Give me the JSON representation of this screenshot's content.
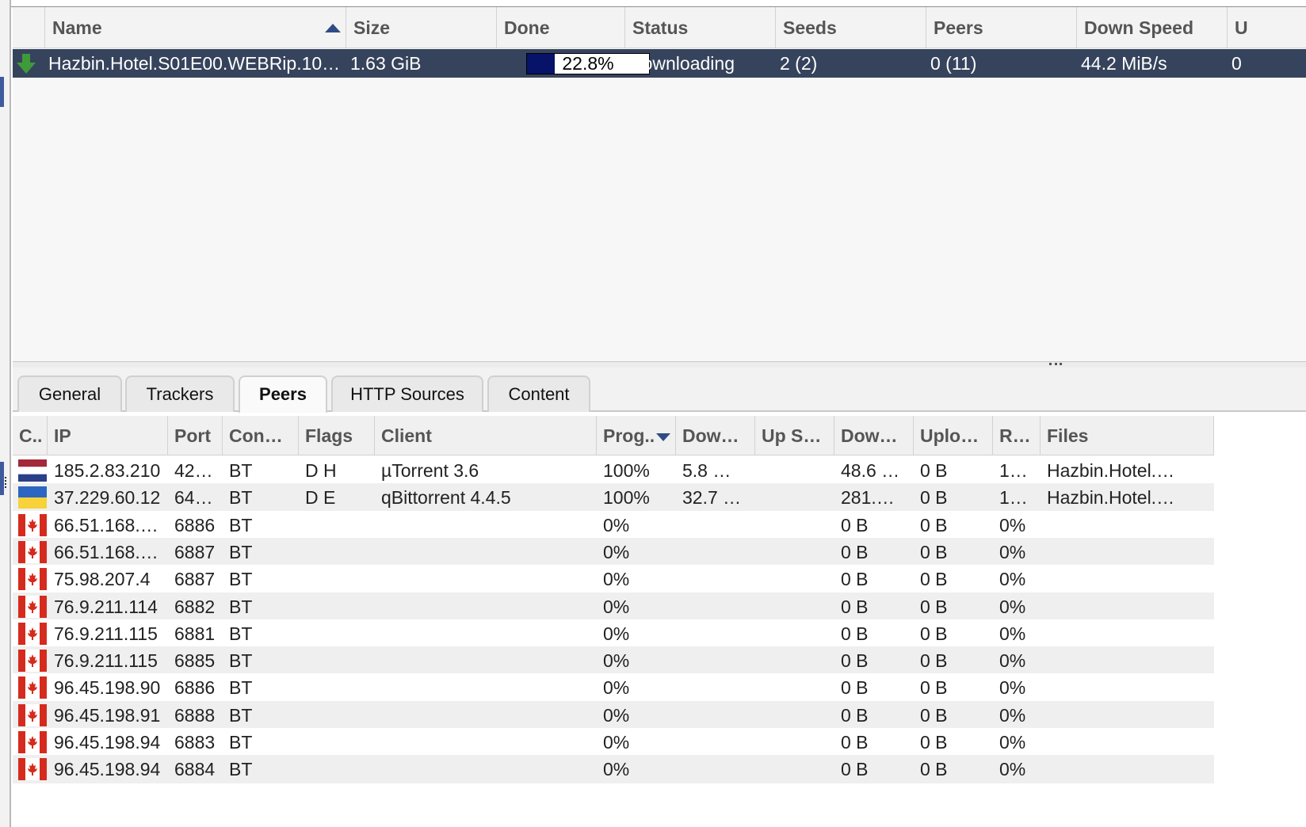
{
  "torrent_list": {
    "columns": {
      "icon": "",
      "name": "Name",
      "size": "Size",
      "done": "Done",
      "status": "Status",
      "seeds": "Seeds",
      "peers": "Peers",
      "down_speed": "Down Speed",
      "up_speed": "U"
    },
    "sorted_column": "name",
    "sort_direction": "ascending",
    "rows": [
      {
        "state_icon": "download-arrow-icon",
        "name": "Hazbin.Hotel.S01E00.WEBRip.10…",
        "size": "1.63 GiB",
        "done_percent": 22.8,
        "done_label": "22.8%",
        "status": "Downloading",
        "seeds": "2 (2)",
        "peers": "0 (11)",
        "down_speed": "44.2 MiB/s",
        "up_speed": "0"
      }
    ]
  },
  "colors": {
    "selected_row_bg": "#36435c",
    "progress_fill": "#071269",
    "sort_indicator": "#2f4b85"
  },
  "tabs": [
    {
      "label": "General",
      "active": false
    },
    {
      "label": "Trackers",
      "active": false
    },
    {
      "label": "Peers",
      "active": true
    },
    {
      "label": "HTTP Sources",
      "active": false
    },
    {
      "label": "Content",
      "active": false
    }
  ],
  "peers": {
    "columns": {
      "country": "C..",
      "ip": "IP",
      "port": "Port",
      "connection": "Con…",
      "flags": "Flags",
      "client": "Client",
      "progress": "Prog..",
      "down_speed": "Dow…",
      "up_speed": "Up S…",
      "downloaded": "Dow…",
      "uploaded": "Uplo…",
      "relevance": "R…",
      "files": "Files"
    },
    "sorted_column": "progress",
    "sort_direction": "descending",
    "rows": [
      {
        "flag": "netherlands",
        "ip": "185.2.83.210",
        "port": "42…",
        "connection": "BT",
        "flags": "D H",
        "client": "µTorrent 3.6",
        "progress": "100%",
        "down_speed": "5.8 …",
        "up_speed": "",
        "downloaded": "48.6 …",
        "uploaded": "0 B",
        "relevance": "1…",
        "files": "Hazbin.Hotel.…"
      },
      {
        "flag": "ukraine",
        "ip": "37.229.60.12",
        "port": "64…",
        "connection": "BT",
        "flags": "D E",
        "client": "qBittorrent 4.4.5",
        "progress": "100%",
        "down_speed": "32.7 …",
        "up_speed": "",
        "downloaded": "281.…",
        "uploaded": "0 B",
        "relevance": "1…",
        "files": "Hazbin.Hotel.…"
      },
      {
        "flag": "canada",
        "ip": "66.51.168.…",
        "port": "6886",
        "connection": "BT",
        "flags": "",
        "client": "",
        "progress": "0%",
        "down_speed": "",
        "up_speed": "",
        "downloaded": "0 B",
        "uploaded": "0 B",
        "relevance": "0%",
        "files": ""
      },
      {
        "flag": "canada",
        "ip": "66.51.168.…",
        "port": "6887",
        "connection": "BT",
        "flags": "",
        "client": "",
        "progress": "0%",
        "down_speed": "",
        "up_speed": "",
        "downloaded": "0 B",
        "uploaded": "0 B",
        "relevance": "0%",
        "files": ""
      },
      {
        "flag": "canada",
        "ip": "75.98.207.4",
        "port": "6887",
        "connection": "BT",
        "flags": "",
        "client": "",
        "progress": "0%",
        "down_speed": "",
        "up_speed": "",
        "downloaded": "0 B",
        "uploaded": "0 B",
        "relevance": "0%",
        "files": ""
      },
      {
        "flag": "canada",
        "ip": "76.9.211.114",
        "port": "6882",
        "connection": "BT",
        "flags": "",
        "client": "",
        "progress": "0%",
        "down_speed": "",
        "up_speed": "",
        "downloaded": "0 B",
        "uploaded": "0 B",
        "relevance": "0%",
        "files": ""
      },
      {
        "flag": "canada",
        "ip": "76.9.211.115",
        "port": "6881",
        "connection": "BT",
        "flags": "",
        "client": "",
        "progress": "0%",
        "down_speed": "",
        "up_speed": "",
        "downloaded": "0 B",
        "uploaded": "0 B",
        "relevance": "0%",
        "files": ""
      },
      {
        "flag": "canada",
        "ip": "76.9.211.115",
        "port": "6885",
        "connection": "BT",
        "flags": "",
        "client": "",
        "progress": "0%",
        "down_speed": "",
        "up_speed": "",
        "downloaded": "0 B",
        "uploaded": "0 B",
        "relevance": "0%",
        "files": ""
      },
      {
        "flag": "canada",
        "ip": "96.45.198.90",
        "port": "6886",
        "connection": "BT",
        "flags": "",
        "client": "",
        "progress": "0%",
        "down_speed": "",
        "up_speed": "",
        "downloaded": "0 B",
        "uploaded": "0 B",
        "relevance": "0%",
        "files": ""
      },
      {
        "flag": "canada",
        "ip": "96.45.198.91",
        "port": "6888",
        "connection": "BT",
        "flags": "",
        "client": "",
        "progress": "0%",
        "down_speed": "",
        "up_speed": "",
        "downloaded": "0 B",
        "uploaded": "0 B",
        "relevance": "0%",
        "files": ""
      },
      {
        "flag": "canada",
        "ip": "96.45.198.94",
        "port": "6883",
        "connection": "BT",
        "flags": "",
        "client": "",
        "progress": "0%",
        "down_speed": "",
        "up_speed": "",
        "downloaded": "0 B",
        "uploaded": "0 B",
        "relevance": "0%",
        "files": ""
      },
      {
        "flag": "canada",
        "ip": "96.45.198.94",
        "port": "6884",
        "connection": "BT",
        "flags": "",
        "client": "",
        "progress": "0%",
        "down_speed": "",
        "up_speed": "",
        "downloaded": "0 B",
        "uploaded": "0 B",
        "relevance": "0%",
        "files": ""
      }
    ]
  }
}
